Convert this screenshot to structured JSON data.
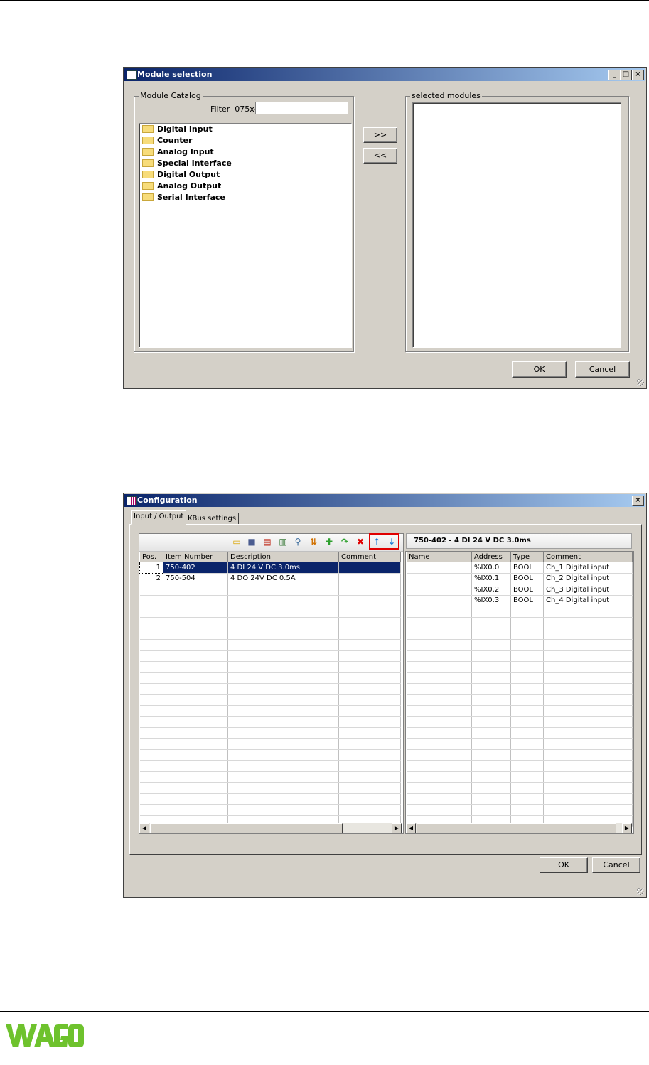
{
  "module_dialog": {
    "title": "Module selection",
    "catalog_group": "Module Catalog",
    "filter_label": "Filter",
    "filter_prefix": "075x-",
    "filter_value": "",
    "tree_items": [
      "Digital Input",
      "Counter",
      "Analog Input",
      "Special Interface",
      "Digital Output",
      "Analog Output",
      "Serial Interface"
    ],
    "add_button": ">>",
    "remove_button": "<<",
    "selected_group": "selected modules",
    "ok": "OK",
    "cancel": "Cancel"
  },
  "config_dialog": {
    "title": "Configuration",
    "tabs": [
      "Input / Output",
      "KBus settings"
    ],
    "module_heading": "750-402 - 4 DI 24 V DC 3.0ms",
    "left_headers": [
      "Pos.",
      "Item Number",
      "Description",
      "Comment"
    ],
    "left_rows": [
      {
        "pos": "1",
        "item": "750-402",
        "desc": "4 DI 24 V DC 3.0ms",
        "comment": ""
      },
      {
        "pos": "2",
        "item": "750-504",
        "desc": "4 DO 24V DC 0.5A",
        "comment": ""
      }
    ],
    "right_headers": [
      "Name",
      "Address",
      "Type",
      "Comment"
    ],
    "right_rows": [
      {
        "name": "",
        "address": "%IX0.0",
        "type": "BOOL",
        "comment": "Ch_1 Digital input"
      },
      {
        "name": "",
        "address": "%IX0.1",
        "type": "BOOL",
        "comment": "Ch_2 Digital input"
      },
      {
        "name": "",
        "address": "%IX0.2",
        "type": "BOOL",
        "comment": "Ch_3 Digital input"
      },
      {
        "name": "",
        "address": "%IX0.3",
        "type": "BOOL",
        "comment": "Ch_4 Digital input"
      }
    ],
    "ok": "OK",
    "cancel": "Cancel"
  },
  "footer": {
    "logo_text": "WAGO",
    "logo_color": "#6ec22d"
  }
}
